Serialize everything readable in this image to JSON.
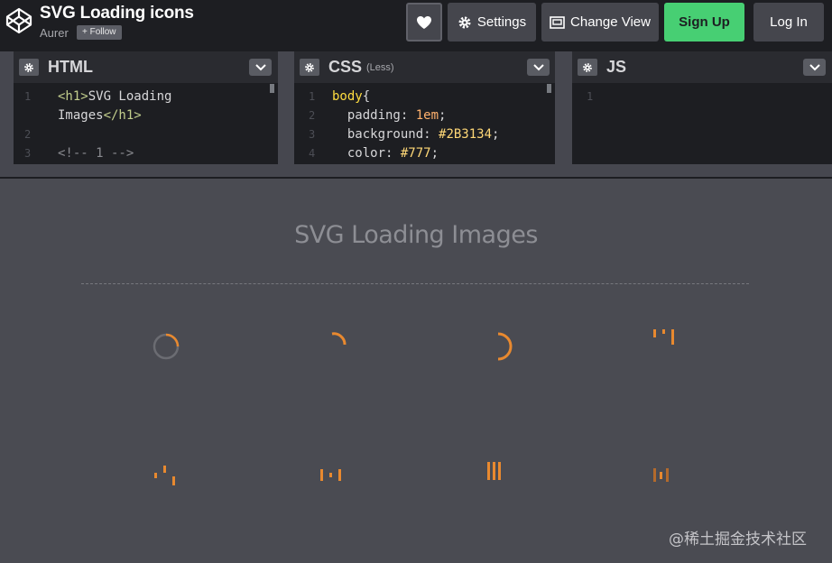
{
  "header": {
    "title": "SVG Loading icons",
    "author": "Aurer",
    "follow_label": "+ Follow",
    "buttons": {
      "settings": "Settings",
      "change_view": "Change View",
      "signup": "Sign Up",
      "login": "Log In"
    }
  },
  "editors": {
    "html": {
      "title": "HTML",
      "lines": [
        {
          "num": "1",
          "text": "<h1>SVG Loading"
        },
        {
          "num": "",
          "text": "Images</h1>"
        },
        {
          "num": "2",
          "text": ""
        },
        {
          "num": "3",
          "text": "<!-- 1 -->"
        }
      ]
    },
    "css": {
      "title": "CSS",
      "subtitle": "(Less)",
      "lines": [
        {
          "num": "1",
          "text": "body{"
        },
        {
          "num": "2",
          "text": "  padding: 1em;"
        },
        {
          "num": "3",
          "text": "  background: #2B3134;"
        },
        {
          "num": "4",
          "text": "  color: #777;"
        }
      ]
    },
    "js": {
      "title": "JS",
      "lines": [
        {
          "num": "1",
          "text": ""
        }
      ]
    }
  },
  "preview": {
    "heading": "SVG Loading Images",
    "loader_color": "#e8892f",
    "loaders": [
      "ring-spinner",
      "arc-small",
      "arc-large",
      "bars-stagger",
      "bars-wave",
      "bars-dots",
      "bars-solid",
      "bars-faded"
    ]
  },
  "watermark": "@稀土掘金技术社区",
  "colors": {
    "signup_green": "#47cf73",
    "header_bg": "#1d1e22",
    "preview_bg": "#4a4b52"
  }
}
